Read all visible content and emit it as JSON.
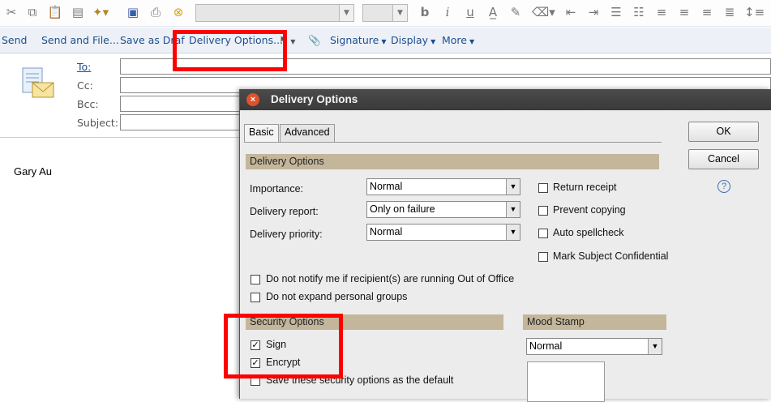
{
  "format_toolbar": {
    "icons": [
      "cut-icon",
      "copy-icon",
      "paste-icon",
      "paste-special-icon",
      "insert-icon",
      "save-icon",
      "print-icon",
      "stop-icon"
    ],
    "format_icons": [
      "bold-icon",
      "italic-icon",
      "underline-icon",
      "text-color-icon",
      "highlight-icon",
      "eraser-icon",
      "indent-icon",
      "outdent-icon",
      "bullet-list-icon",
      "numbered-list-icon",
      "align-left-icon",
      "align-center-icon",
      "align-right-icon",
      "justify-icon",
      "line-spacing-icon"
    ]
  },
  "action_bar": {
    "send": "Send",
    "send_and_file": "Send and File...",
    "save_as_draft": "Save as Draf",
    "delivery_options": "Delivery Options...",
    "signature": "Signature",
    "display": "Display",
    "more": "More"
  },
  "header": {
    "to_label": "To:",
    "cc_label": "Cc:",
    "bcc_label": "Bcc:",
    "subject_label": "Subject:"
  },
  "body": {
    "sender_name": "Gary Au"
  },
  "dialog": {
    "title": "Delivery Options",
    "tabs": [
      "Basic",
      "Advanced"
    ],
    "ok": "OK",
    "cancel": "Cancel",
    "help": "?",
    "delivery_section": "Delivery Options",
    "importance_label": "Importance:",
    "importance_value": "Normal",
    "delivery_report_label": "Delivery report:",
    "delivery_report_value": "Only on failure",
    "delivery_priority_label": "Delivery priority:",
    "delivery_priority_value": "Normal",
    "return_receipt": "Return receipt",
    "prevent_copying": "Prevent copying",
    "auto_spellcheck": "Auto spellcheck",
    "mark_confidential": "Mark Subject Confidential",
    "do_not_notify": "Do not notify me if recipient(s) are running Out of Office",
    "do_not_expand": "Do not expand personal groups",
    "security_section": "Security Options",
    "sign": "Sign",
    "sign_checked": true,
    "encrypt": "Encrypt",
    "encrypt_checked": true,
    "save_default": "Save these security options as the default",
    "mood_section": "Mood Stamp",
    "mood_value": "Normal"
  },
  "colors": {
    "highlight": "#ff0000",
    "section": "#c4b69a",
    "link": "#1c4e8f"
  }
}
